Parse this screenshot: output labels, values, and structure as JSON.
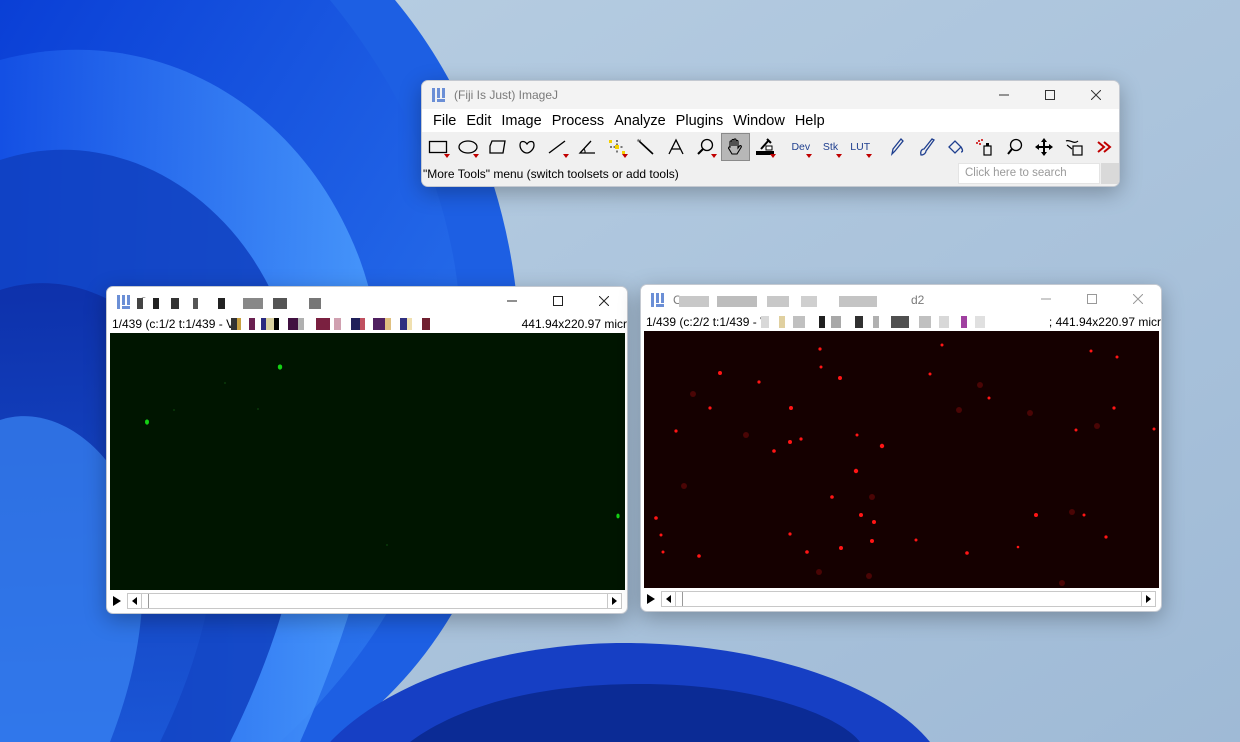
{
  "fiji": {
    "title": "(Fiji Is Just) ImageJ",
    "menu": [
      "File",
      "Edit",
      "Image",
      "Process",
      "Analyze",
      "Plugins",
      "Window",
      "Help"
    ],
    "tool_labels": {
      "dev": "Dev",
      "stk": "Stk",
      "lut": "LUT"
    },
    "status": "\"More Tools\" menu (switch toolsets or add tools)",
    "search_placeholder": "Click here to search"
  },
  "windows": [
    {
      "title_prefix": "C",
      "info_left": "1/439 (c:1/2 t:1/439 - V",
      "info_right": "441.94x220.97 micr",
      "channel_color": "#00ff00"
    },
    {
      "title_prefix": "C",
      "title_suffix": "d2",
      "info_left": "1/439 (c:2/2 t:1/439 - V",
      "info_right": "; 441.94x220.97 micr",
      "channel_color": "#ff0000"
    }
  ],
  "icons": [
    "fiji-logo-icon",
    "minimize-icon",
    "maximize-icon",
    "close-icon",
    "play-icon",
    "scroll-left-icon",
    "scroll-right-icon"
  ]
}
